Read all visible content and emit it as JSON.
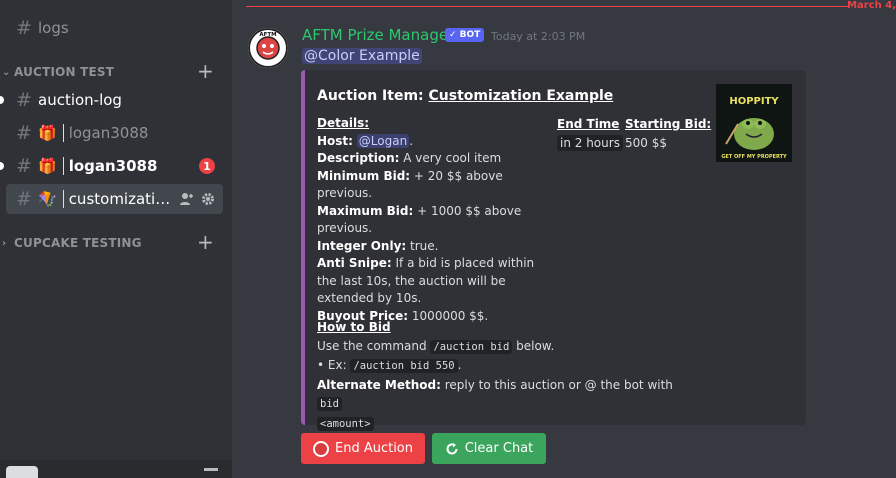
{
  "sidebar": {
    "channels": [
      {
        "label": "logs",
        "state": "muted"
      },
      {
        "label": "auction-log",
        "state": "unread"
      },
      {
        "label": "logan3088",
        "state": "muted",
        "emoji": "🎁"
      },
      {
        "label": "logan3088",
        "state": "unread",
        "emoji": "🎁",
        "badge": "1"
      },
      {
        "label": "customization...",
        "state": "active",
        "emoji": "🪁"
      }
    ],
    "categories": [
      {
        "label": "AUCTION TEST"
      },
      {
        "label": "CUPCAKE TESTING"
      }
    ]
  },
  "chat": {
    "date_divider": "March 4,",
    "author": "AFTM Prize Manager",
    "bot_tag": "✓ BOT",
    "timestamp": "Today at 2:03 PM",
    "mention": "@Color Example",
    "embed": {
      "color": "#9b59b6",
      "title_prefix": "Auction Item: ",
      "title_link": "Customization Example",
      "details_header": "Details:",
      "host_label": "Host:",
      "host_value": "@Logan",
      "host_suffix": ".",
      "description_label": "Description:",
      "description_value": " A very cool item",
      "min_bid_label": "Minimum Bid:",
      "min_bid_value": " + 20 $$ above previous.",
      "max_bid_label": "Maximum Bid:",
      "max_bid_value": " + 1000 $$ above previous.",
      "integer_label": "Integer Only:",
      "integer_value": " true.",
      "anti_snipe_label": "Anti Snipe:",
      "anti_snipe_value": " If a bid is placed within the last 10s, the auction will be extended by 10s.",
      "buyout_label": "Buyout Price:",
      "buyout_value": " 1000000 $$.",
      "end_time_header": "End Time",
      "end_time_value": "in 2 hours",
      "starting_bid_header": "Starting Bid:",
      "starting_bid_value": "500 $$",
      "how_to_header": "How to Bid",
      "use_command_prefix": "Use the command ",
      "use_command_code": "/auction bid",
      "use_command_suffix": " below.",
      "example_prefix": "• Ex: ",
      "example_code": "/auction bid 550",
      "example_suffix": ".",
      "alt_label": "Alternate Method:",
      "alt_value": " reply to this auction or @ the bot with ",
      "alt_code_1": "bid",
      "alt_code_2": "<amount>",
      "thumbnail_top": "HOPPITY",
      "thumbnail_bottom": "GET OFF MY PROPERTY"
    },
    "buttons": {
      "end_auction": "End Auction",
      "clear_chat": "Clear Chat"
    },
    "avatar_text": "AFTM"
  }
}
